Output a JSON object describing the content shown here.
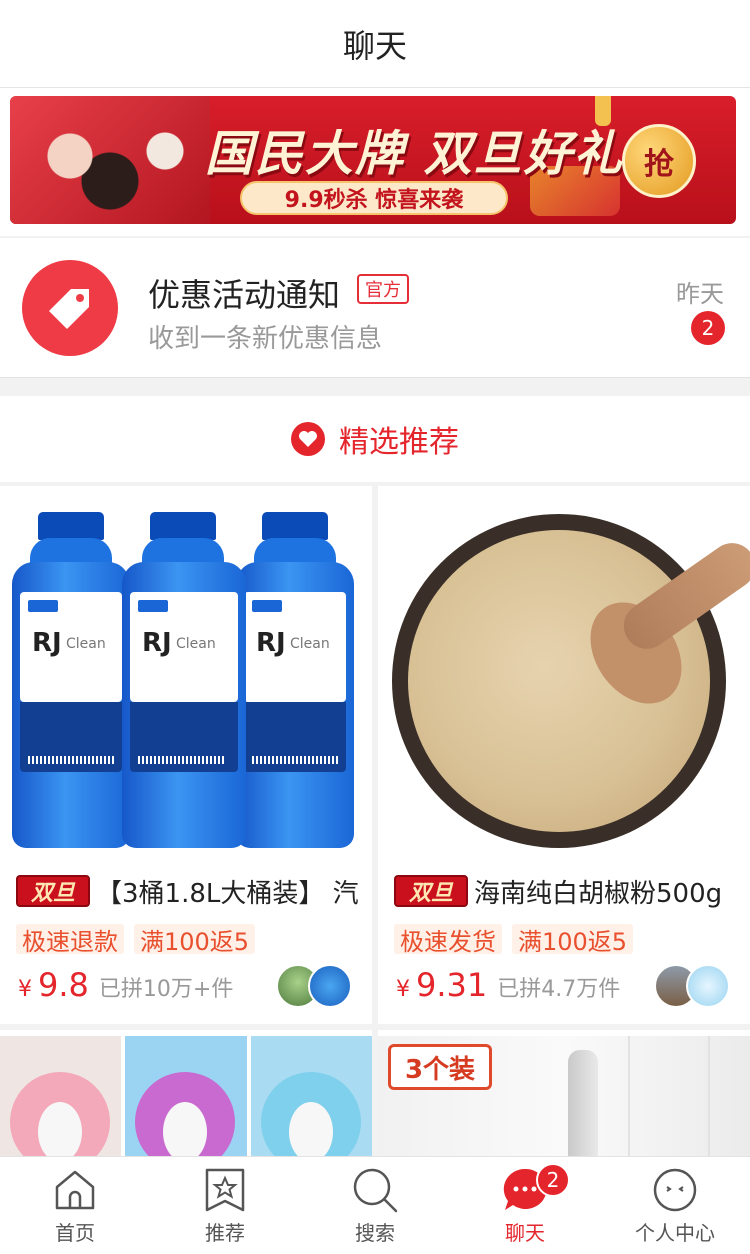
{
  "header": {
    "title": "聊天"
  },
  "banner": {
    "title": "国民大牌 双旦好礼",
    "subtitle": "9.9秒杀 惊喜来袭",
    "grab_label": "抢"
  },
  "notification": {
    "title": "优惠活动通知",
    "tag": "官方",
    "subtitle": "收到一条新优惠信息",
    "time": "昨天",
    "unread": "2",
    "icon": "tag-icon",
    "accent": "#ef3b45"
  },
  "section": {
    "title": "精选推荐",
    "icon": "heart-icon"
  },
  "products": [
    {
      "badge": "双旦",
      "title": "【3桶1.8L大桶装】 汽",
      "tags": [
        "极速退款",
        "满100返5"
      ],
      "currency": "¥",
      "price": "9.8",
      "sold": "已拼10万+件",
      "label_brand": "RJ",
      "label_suffix": "Clean"
    },
    {
      "badge": "双旦",
      "title": "海南纯白胡椒粉500g",
      "tags": [
        "极速发货",
        "满100返5"
      ],
      "currency": "¥",
      "price": "9.31",
      "sold": "已拼4.7万件"
    },
    {
      "kind": "seat-covers"
    },
    {
      "pack_label": "3个装"
    }
  ],
  "tabbar": {
    "items": [
      {
        "label": "首页",
        "icon": "home-icon"
      },
      {
        "label": "推荐",
        "icon": "star-bookmark-icon"
      },
      {
        "label": "搜索",
        "icon": "search-icon"
      },
      {
        "label": "聊天",
        "icon": "chat-icon",
        "badge": "2",
        "active": true
      },
      {
        "label": "个人中心",
        "icon": "profile-icon"
      }
    ]
  },
  "colors": {
    "brand_red": "#e5252c",
    "tag_orange": "#e8502e"
  }
}
